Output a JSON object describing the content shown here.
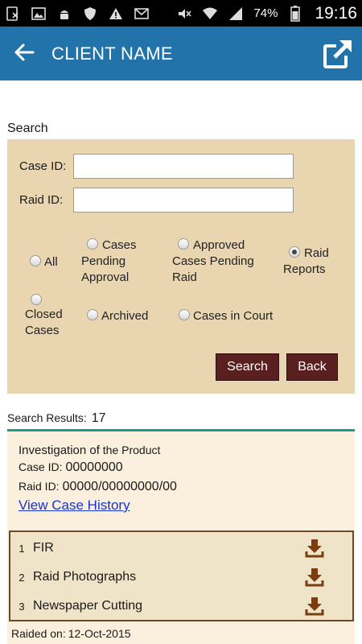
{
  "status_bar": {
    "battery": "74%",
    "time": "19:16"
  },
  "app_bar": {
    "title": "CLIENT NAME"
  },
  "search": {
    "heading": "Search",
    "case_id_label": "Case ID:",
    "case_id_value": "",
    "raid_id_label": "Raid ID:",
    "raid_id_value": "",
    "filters": [
      {
        "label": "All",
        "checked": false
      },
      {
        "label": "Cases Pending Approval",
        "checked": false
      },
      {
        "label": "Approved Cases Pending Raid",
        "checked": false
      },
      {
        "label": "Raid Reports",
        "checked": true
      },
      {
        "label": "Closed Cases",
        "checked": false
      },
      {
        "label": "Archived",
        "checked": false
      },
      {
        "label": "Cases in Court",
        "checked": false
      }
    ],
    "search_button": "Search",
    "back_button": "Back"
  },
  "results": {
    "label": "Search Results:",
    "count": "17",
    "card": {
      "heading_bold": "Investigation of",
      "heading_rest": "the Product",
      "case_id_label": "Case ID:",
      "case_id_value": "00000000",
      "raid_id_label": "Raid ID:",
      "raid_id_value": "00000/00000000/00",
      "history_link": "View Case History",
      "documents": [
        {
          "num": "1",
          "name": "FIR",
          "icon": "download-icon"
        },
        {
          "num": "2",
          "name": "Raid Photographs",
          "icon": "download-icon"
        },
        {
          "num": "3",
          "name": "Newspaper Cutting",
          "icon": "download-icon"
        }
      ],
      "raided_label": "Raided on:",
      "raided_value": "12-Oct-2015"
    }
  },
  "colors": {
    "app_bar": "#2173aa",
    "panel": "#e9d6b0",
    "button": "#5a2020",
    "rule": "#1e9a8a",
    "link": "#1a33cc"
  }
}
